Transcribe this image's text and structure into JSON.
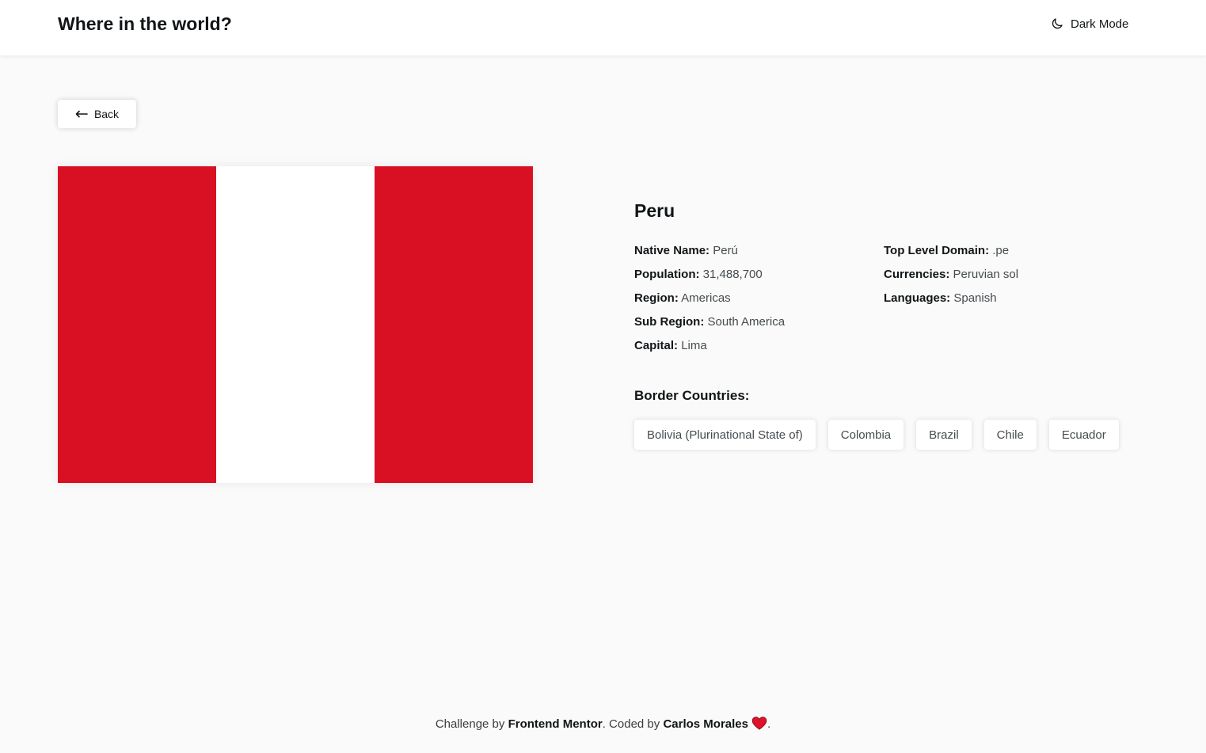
{
  "header": {
    "title": "Where in the world?",
    "dark_mode_label": "Dark Mode",
    "dark_mode_icon": "moon-icon"
  },
  "navigation": {
    "back_label": "Back",
    "back_icon": "arrow-left-icon"
  },
  "country": {
    "name": "Peru",
    "flag": {
      "stripes": [
        "#d91023",
        "#ffffff",
        "#d91023"
      ]
    },
    "details_left": [
      {
        "label": "Native Name:",
        "value": "Perú"
      },
      {
        "label": "Population:",
        "value": "31,488,700"
      },
      {
        "label": "Region:",
        "value": "Americas"
      },
      {
        "label": "Sub Region:",
        "value": "South America"
      },
      {
        "label": "Capital:",
        "value": "Lima"
      }
    ],
    "details_right": [
      {
        "label": "Top Level Domain:",
        "value": ".pe"
      },
      {
        "label": "Currencies:",
        "value": "Peruvian sol"
      },
      {
        "label": "Languages:",
        "value": "Spanish"
      }
    ],
    "border_title": "Border Countries:",
    "border_countries": [
      "Bolivia (Plurinational State of)",
      "Colombia",
      "Brazil",
      "Chile",
      "Ecuador"
    ]
  },
  "footer": {
    "prefix": "Challenge by ",
    "challenge_by": "Frontend Mentor",
    "middle": ". Coded by ",
    "coded_by": "Carlos Morales",
    "suffix": ".",
    "heart_icon": "heart-icon"
  },
  "colors": {
    "background": "#fafafa",
    "surface": "#ffffff",
    "text": "#111517",
    "muted_text": "#454b4e",
    "heart": "#e0112b"
  }
}
